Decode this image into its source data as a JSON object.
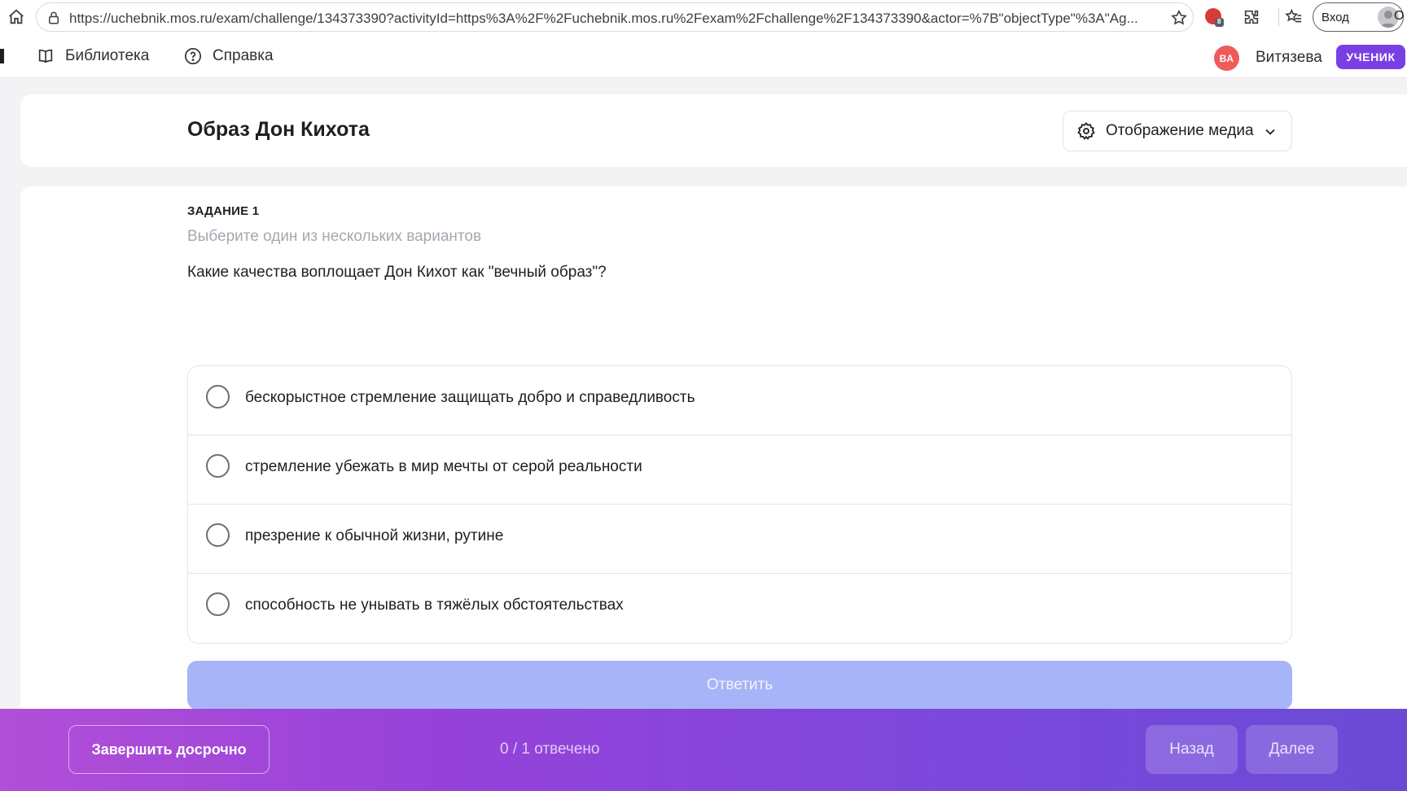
{
  "browser": {
    "url": "https://uchebnik.mos.ru/exam/challenge/134373390?activityId=https%3A%2F%2Fuchebnik.mos.ru%2Fexam%2Fchallenge%2F134373390&actor=%7B\"objectType\"%3A\"Ag...",
    "signin_label": "Вход",
    "cut_label": "О",
    "ext_badge_count": "8"
  },
  "header": {
    "nav": [
      {
        "label": "Библиотека",
        "icon": "book-icon"
      },
      {
        "label": "Справка",
        "icon": "help-circle-icon"
      }
    ],
    "user": {
      "initials": "ВА",
      "name": "Витязева",
      "role": "УЧЕНИК"
    }
  },
  "title_card": {
    "title": "Образ Дон Кихота",
    "media_button": "Отображение медиа"
  },
  "task": {
    "number_label": "ЗАДАНИЕ 1",
    "hint": "Выберите один из нескольких вариантов",
    "question": "Какие качества воплощает Дон Кихот как \"вечный образ\"?",
    "options": [
      "бескорыстное стремление защищать добро и справедливость",
      "стремление убежать в мир мечты от серой реальности",
      "презрение к обычной жизни, рутине",
      "способность не унывать в тяжёлых обстоятельствах"
    ],
    "answer_label": "Ответить"
  },
  "bottom_bar": {
    "finish_label": "Завершить досрочно",
    "progress": "0 / 1 отвечено",
    "back_label": "Назад",
    "next_label": "Далее"
  },
  "colors": {
    "accent": "#7a3fe4",
    "answer_disabled": "#a7b4f7",
    "avatar": "#ef5b5b"
  }
}
